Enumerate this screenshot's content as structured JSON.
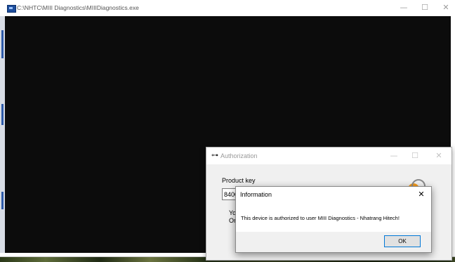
{
  "console": {
    "title": "C:\\NHTC\\MIII Diagnostics\\MIIIDiagnostics.exe",
    "minimize": "—",
    "maximize": "☐",
    "close": "✕"
  },
  "auth": {
    "title": "Authorization",
    "key_icon": "key-icon",
    "product_key_label": "Product key",
    "product_key_value": "8400",
    "line1": "Yo",
    "line2": "Or",
    "minimize": "—",
    "maximize": "☐",
    "close": "✕"
  },
  "info": {
    "title": "Information",
    "close": "✕",
    "message": "This device is authorized to user MIII Diagnostics - Nhatrang Hitech!",
    "ok_label": "OK"
  },
  "colors": {
    "console_bg": "#0c0c0c",
    "accent": "#0078d7",
    "logo_orange": "#f39a1c"
  }
}
